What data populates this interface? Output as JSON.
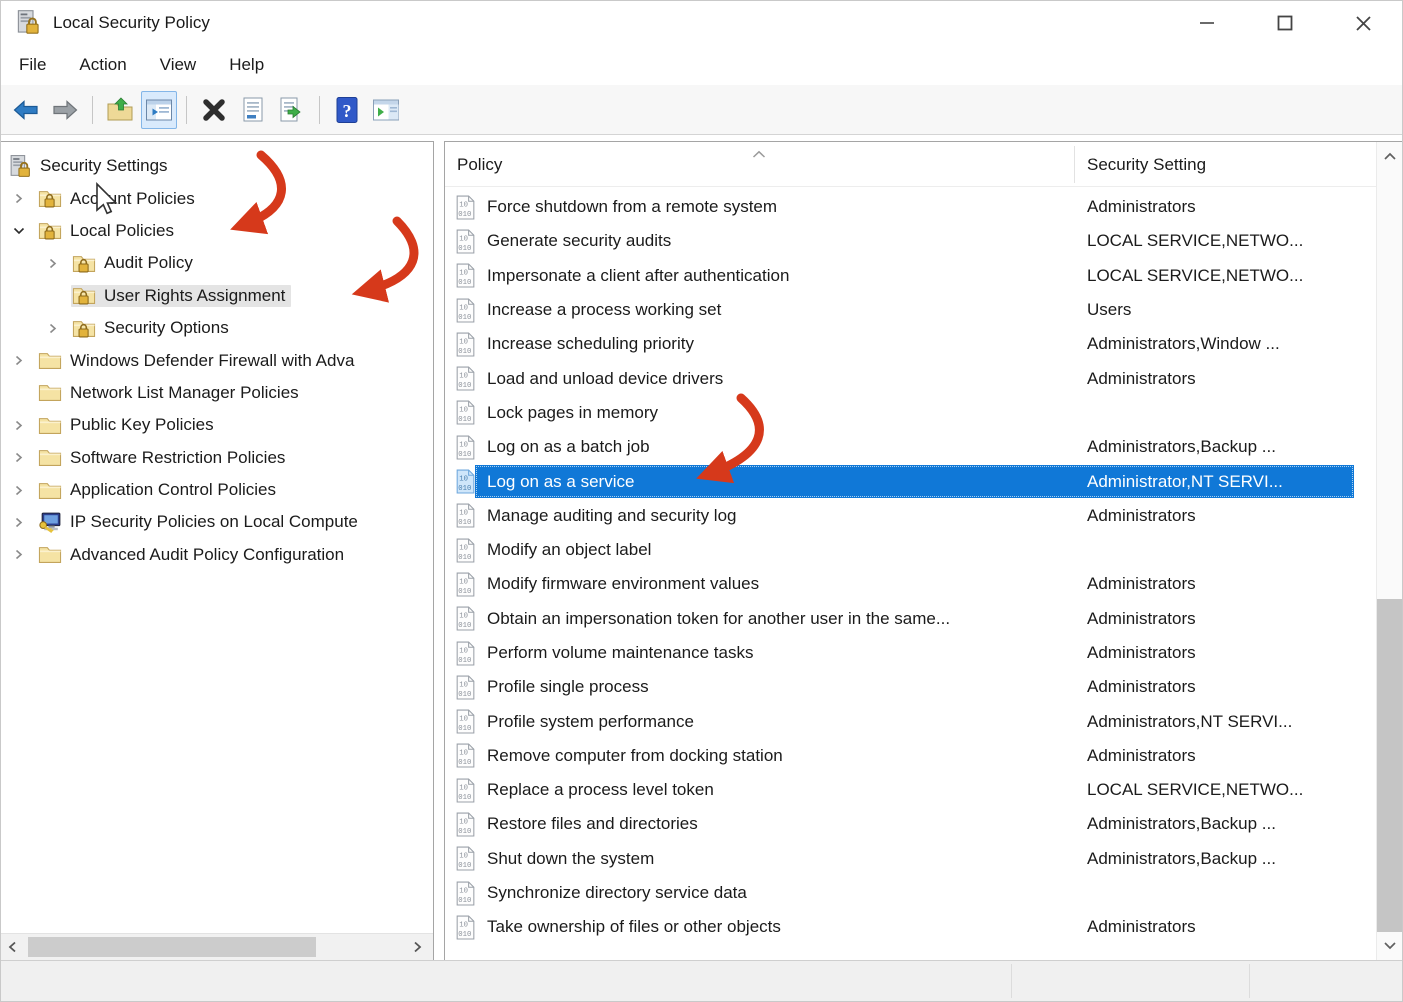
{
  "window": {
    "title": "Local Security Policy"
  },
  "titlebar": {
    "controls": [
      "minimize",
      "maximize",
      "close"
    ]
  },
  "menubar": {
    "items": [
      "File",
      "Action",
      "View",
      "Help"
    ]
  },
  "toolbar": {
    "buttons": [
      "back",
      "forward",
      "up-one-level",
      "show-hide-console-tree",
      "delete",
      "properties",
      "export-list",
      "help",
      "show-hide-action-pane"
    ],
    "active_button": "show-hide-console-tree"
  },
  "tree": {
    "items": [
      {
        "label": "Security Settings",
        "level": 0,
        "icon": "security-settings",
        "chevron": "none",
        "selected": false
      },
      {
        "label": "Account Policies",
        "level": 1,
        "icon": "folder-lock",
        "chevron": "right",
        "selected": false
      },
      {
        "label": "Local Policies",
        "level": 1,
        "icon": "folder-lock",
        "chevron": "down",
        "selected": false
      },
      {
        "label": "Audit Policy",
        "level": 2,
        "icon": "folder-lock",
        "chevron": "right",
        "selected": false
      },
      {
        "label": "User Rights Assignment",
        "level": 2,
        "icon": "folder-lock",
        "chevron": "none",
        "selected": true
      },
      {
        "label": "Security Options",
        "level": 2,
        "icon": "folder-lock",
        "chevron": "right",
        "selected": false
      },
      {
        "label": "Windows Defender Firewall with Adva",
        "level": 1,
        "icon": "folder",
        "chevron": "right",
        "selected": false
      },
      {
        "label": "Network List Manager Policies",
        "level": 1,
        "icon": "folder",
        "chevron": "none",
        "selected": false
      },
      {
        "label": "Public Key Policies",
        "level": 1,
        "icon": "folder",
        "chevron": "right",
        "selected": false
      },
      {
        "label": "Software Restriction Policies",
        "level": 1,
        "icon": "folder",
        "chevron": "right",
        "selected": false
      },
      {
        "label": "Application Control Policies",
        "level": 1,
        "icon": "folder",
        "chevron": "right",
        "selected": false
      },
      {
        "label": "IP Security Policies on Local Compute",
        "level": 1,
        "icon": "computer-key",
        "chevron": "right",
        "selected": false
      },
      {
        "label": "Advanced Audit Policy Configuration",
        "level": 1,
        "icon": "folder",
        "chevron": "right",
        "selected": false
      }
    ]
  },
  "list": {
    "columns": [
      "Policy",
      "Security Setting"
    ],
    "sort": "ascending",
    "rows": [
      {
        "policy": "Force shutdown from a remote system",
        "setting": "Administrators",
        "selected": false
      },
      {
        "policy": "Generate security audits",
        "setting": "LOCAL SERVICE,NETWO...",
        "selected": false
      },
      {
        "policy": "Impersonate a client after authentication",
        "setting": "LOCAL SERVICE,NETWO...",
        "selected": false
      },
      {
        "policy": "Increase a process working set",
        "setting": "Users",
        "selected": false
      },
      {
        "policy": "Increase scheduling priority",
        "setting": "Administrators,Window ...",
        "selected": false
      },
      {
        "policy": "Load and unload device drivers",
        "setting": "Administrators",
        "selected": false
      },
      {
        "policy": "Lock pages in memory",
        "setting": "",
        "selected": false
      },
      {
        "policy": "Log on as a batch job",
        "setting": "Administrators,Backup ...",
        "selected": false
      },
      {
        "policy": "Log on as a service",
        "setting": "Administrator,NT SERVI...",
        "selected": true
      },
      {
        "policy": "Manage auditing and security log",
        "setting": "Administrators",
        "selected": false
      },
      {
        "policy": "Modify an object label",
        "setting": "",
        "selected": false
      },
      {
        "policy": "Modify firmware environment values",
        "setting": "Administrators",
        "selected": false
      },
      {
        "policy": "Obtain an impersonation token for another user in the same...",
        "setting": "Administrators",
        "selected": false
      },
      {
        "policy": "Perform volume maintenance tasks",
        "setting": "Administrators",
        "selected": false
      },
      {
        "policy": "Profile single process",
        "setting": "Administrators",
        "selected": false
      },
      {
        "policy": "Profile system performance",
        "setting": "Administrators,NT SERVI...",
        "selected": false
      },
      {
        "policy": "Remove computer from docking station",
        "setting": "Administrators",
        "selected": false
      },
      {
        "policy": "Replace a process level token",
        "setting": "LOCAL SERVICE,NETWO...",
        "selected": false
      },
      {
        "policy": "Restore files and directories",
        "setting": "Administrators,Backup ...",
        "selected": false
      },
      {
        "policy": "Shut down the system",
        "setting": "Administrators,Backup ...",
        "selected": false
      },
      {
        "policy": "Synchronize directory service data",
        "setting": "",
        "selected": false
      },
      {
        "policy": "Take ownership of files or other objects",
        "setting": "Administrators",
        "selected": false
      }
    ]
  },
  "annotations": {
    "arrow_targets": [
      "Local Policies",
      "User Rights Assignment",
      "Log on as a service"
    ]
  },
  "colors": {
    "selection_blue": "#1078d7",
    "tree_selection_gray": "#e4e4e4",
    "annotation_red": "#d6391b",
    "toolbar_highlight": "#d9eafc"
  }
}
